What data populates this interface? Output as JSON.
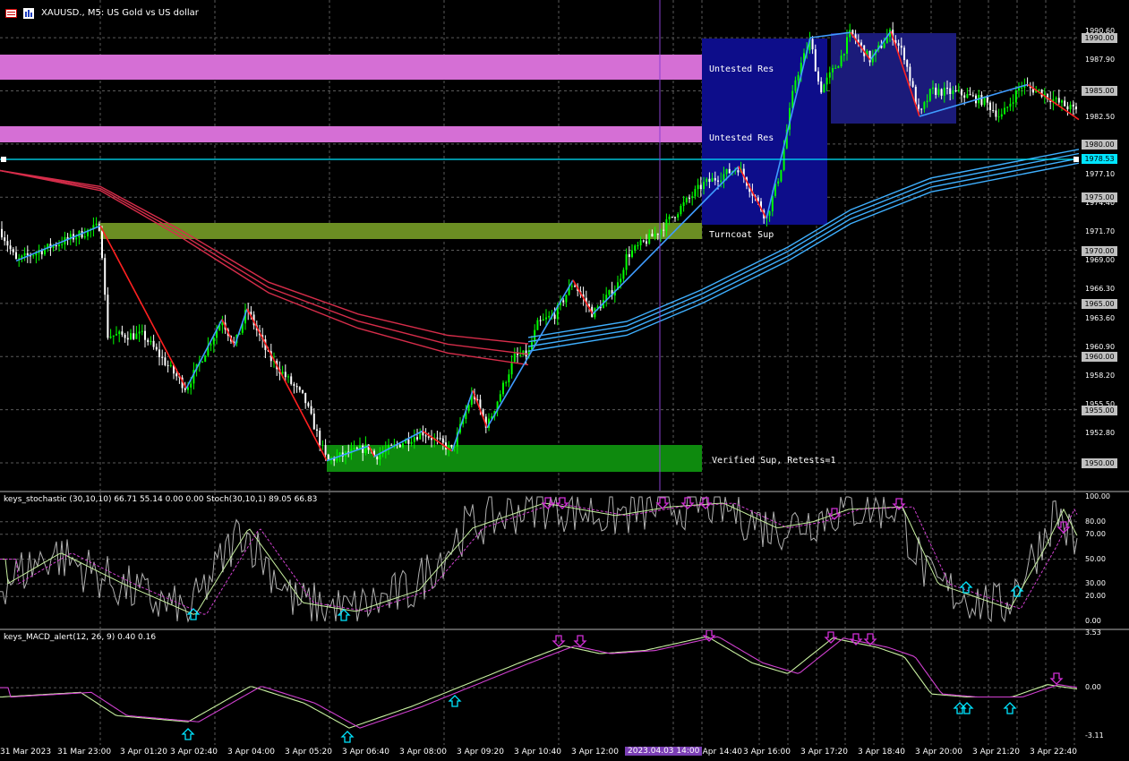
{
  "header": {
    "symbol_title": "XAUUSD., M5: US Gold vs US dollar"
  },
  "price_axis": {
    "labels": [
      "1990.60",
      "1987.90",
      "1982.50",
      "1977.10",
      "1974.40",
      "1971.70",
      "1969.00",
      "1966.30",
      "1963.60",
      "1960.90",
      "1958.20",
      "1955.50",
      "1952.80"
    ],
    "boxed": [
      "1990.00",
      "1985.00",
      "1980.00",
      "1975.00",
      "1970.00",
      "1965.00",
      "1960.00",
      "1955.00",
      "1950.00"
    ],
    "current": "1978.53",
    "current_color": "#00e5ff"
  },
  "zones": {
    "untested_res_1": "Untested Res",
    "untested_res_2": "Untested Res",
    "turncoat_sup": "Turncoat Sup",
    "verified_sup": "Verified Sup, Retests=1",
    "colors": {
      "resistance": "#d56fd5",
      "turncoat": "#6b8e23",
      "support": "#0e8a0e",
      "box": "#0d0d8a"
    }
  },
  "stochastic": {
    "title": "keys_stochastic (30,10,10) 66.71 55.14 0.00 0.00 Stoch(30,10,1) 89.05 66.83",
    "axis": [
      "100.00",
      "80.00",
      "70.00",
      "50.00",
      "30.00",
      "20.00",
      "0.00"
    ]
  },
  "macd": {
    "title": "keys_MACD_alert(12, 26, 9) 0.40 0.16",
    "axis": [
      "3.53",
      "0.00",
      "-3.11"
    ]
  },
  "time_axis": {
    "labels": [
      "31 Mar 2023",
      "31 Mar 23:00",
      "3 Apr 01:20",
      "3 Apr 02:40",
      "3 Apr 04:00",
      "3 Apr 05:20",
      "3 Apr 06:40",
      "3 Apr 08:00",
      "3 Apr 09:20",
      "3 Apr 10:40",
      "3 Apr 12:00",
      "3 Apr 14:40",
      "3 Apr 16:00",
      "3 Apr 17:20",
      "3 Apr 18:40",
      "3 Apr 20:00",
      "3 Apr 21:20",
      "3 Apr 22:40"
    ],
    "selected": "2023.04.03 14:00"
  },
  "colors": {
    "bull": "#00ff00",
    "bear": "#ffffff",
    "zigzag_up": "#3f9cff",
    "zigzag_down": "#ff2020",
    "ma_red": "#d62d4a",
    "ma_blue": "#3fb0ff",
    "crosshair": "#8a3fd1",
    "arrow_up": "#00e5ff",
    "arrow_down": "#d12fd6"
  }
}
